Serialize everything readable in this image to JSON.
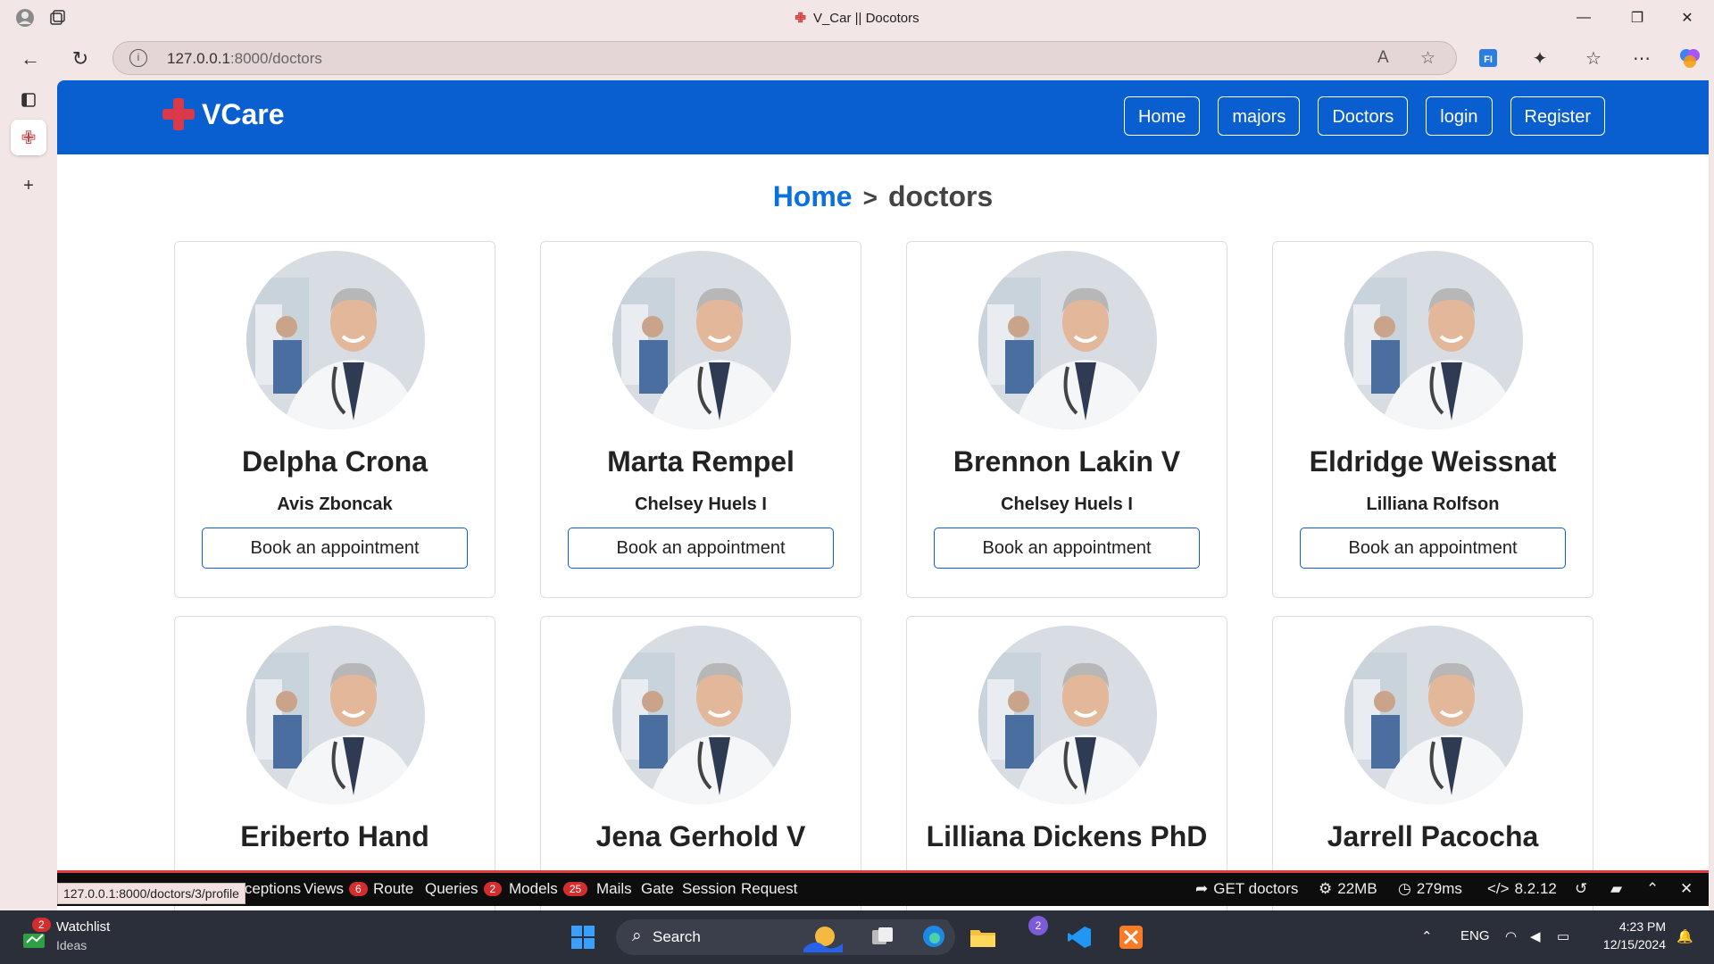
{
  "window": {
    "title": "V_Car || Docotors",
    "controls": [
      "—",
      "❐",
      "✕"
    ]
  },
  "browser": {
    "url_host": "127.0.0.1",
    "url_path": ":8000/doctors",
    "status_url": "127.0.0.1:8000/doctors/3/profile"
  },
  "site": {
    "brand": "VCare",
    "nav": [
      {
        "label": "Home"
      },
      {
        "label": "majors"
      },
      {
        "label": "Doctors"
      },
      {
        "label": "login"
      },
      {
        "label": "Register"
      }
    ],
    "breadcrumb": {
      "home": "Home",
      "sep": ">",
      "current": "doctors"
    }
  },
  "doctors": [
    {
      "name": "Delpha Crona",
      "major": "Avis Zboncak",
      "action": "Book an appointment"
    },
    {
      "name": "Marta Rempel",
      "major": "Chelsey Huels I",
      "action": "Book an appointment"
    },
    {
      "name": "Brennon Lakin V",
      "major": "Chelsey Huels I",
      "action": "Book an appointment"
    },
    {
      "name": "Eldridge Weissnat",
      "major": "Lilliana Rolfson",
      "action": "Book an appointment"
    },
    {
      "name": "Eriberto Hand"
    },
    {
      "name": "Jena Gerhold V"
    },
    {
      "name": "Lilliana Dickens PhD"
    },
    {
      "name": "Jarrell Pacocha"
    }
  ],
  "debugbar": {
    "tabs": [
      {
        "label": "Exceptions"
      },
      {
        "label": "Views",
        "badge": "6"
      },
      {
        "label": "Route"
      },
      {
        "label": "Queries",
        "badge": "2"
      },
      {
        "label": "Models",
        "badge": "25"
      },
      {
        "label": "Mails"
      },
      {
        "label": "Gate"
      },
      {
        "label": "Session"
      },
      {
        "label": "Request"
      }
    ],
    "request": "GET doctors",
    "memory": "22MB",
    "time": "279ms",
    "version": "8.2.12"
  },
  "taskbar": {
    "watchlist": "Watchlist",
    "watchlist_sub": "Ideas",
    "watchlist_badge": "2",
    "search_placeholder": "Search",
    "app_badge": "2",
    "language": "ENG",
    "time": "4:23 PM",
    "date": "12/15/2024"
  },
  "colors": {
    "navbar": "#0a5fd0",
    "accent": "#0a6fe0",
    "debug_badge": "#d42d2d"
  }
}
